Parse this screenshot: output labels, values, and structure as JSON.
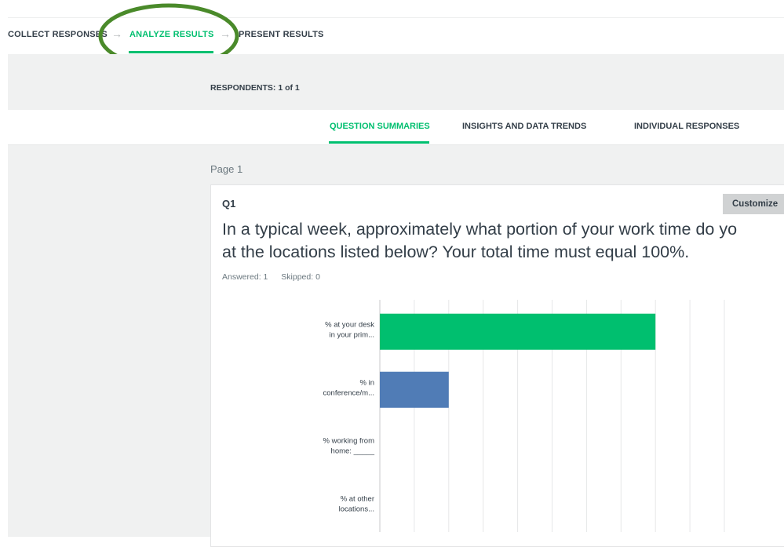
{
  "topnav": {
    "collect": "COLLECT RESPONSES",
    "analyze": "ANALYZE RESULTS",
    "present": "PRESENT RESULTS",
    "arrow": "→"
  },
  "respondents": "RESPONDENTS: 1 of 1",
  "tabs": {
    "question_summaries": "QUESTION SUMMARIES",
    "insights": "INSIGHTS AND DATA TRENDS",
    "individual": "INDIVIDUAL RESPONSES"
  },
  "page_label": "Page 1",
  "question": {
    "number": "Q1",
    "customize_label": "Customize",
    "text_line1": "In a typical week, approximately what portion of your work time do yo",
    "text_line2": "at the locations listed below? Your total time must equal 100%.",
    "answered": "Answered: 1",
    "skipped": "Skipped: 0"
  },
  "colors": {
    "accent": "#00bf6f",
    "bar_green": "#00bf6f",
    "bar_blue": "#507cb6",
    "highlight_ring": "#4a8a2a"
  },
  "chart_data": {
    "type": "bar",
    "orientation": "horizontal",
    "categories": [
      [
        "% at your desk",
        "in your prim..."
      ],
      [
        "% in",
        "conference/m..."
      ],
      [
        "% working from",
        "home: _____"
      ],
      [
        "% at other",
        "locations..."
      ]
    ],
    "values": [
      80,
      20,
      0,
      0
    ],
    "bar_colors": [
      "#00bf6f",
      "#507cb6",
      "#00bf6f",
      "#00bf6f"
    ],
    "xlim": [
      0,
      100
    ],
    "grid": true
  }
}
